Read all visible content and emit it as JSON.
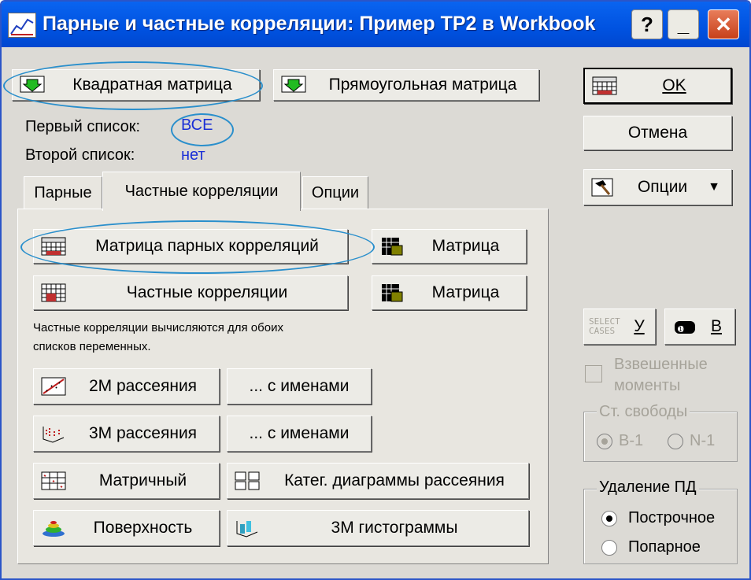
{
  "window": {
    "title": "Парные и частные корреляции: Пример ТР2 в Workbook",
    "help_btn": "?",
    "min_btn": "_",
    "close_btn": "✕"
  },
  "top_buttons": {
    "square_matrix": "Квадратная матрица",
    "rect_matrix": "Прямоугольная матрица"
  },
  "lists": {
    "first_label": "Первый список:",
    "first_value": "ВСЕ",
    "second_label": "Второй список:",
    "second_value": "нет"
  },
  "tabs": [
    "Парные",
    "Частные корреляции",
    "Опции"
  ],
  "panel": {
    "pair_matrix": "Матрица парных корреляций",
    "matrix1": "Матрица",
    "partial": "Частные корреляции",
    "matrix2": "Матрица",
    "note_line1": "Частные корреляции вычисляются для обоих",
    "note_line2": "списков переменных.",
    "scatter2d": "2М рассеяния",
    "with_names1": "... с именами",
    "scatter3d": "3М рассеяния",
    "with_names2": "... с именами",
    "matrix_plot": "Матричный",
    "categ": "Катег. диаграммы рассеяния",
    "surface": "Поверхность",
    "hist3d": "3М гистограммы"
  },
  "right": {
    "ok": "OK",
    "cancel": "Отмена",
    "options": "Опции",
    "select_cases": "SELECT CASES",
    "select_key": "У",
    "weight_key": "В",
    "weighted_line1": "Взвешенные",
    "weighted_line2": "моменты",
    "df_group": "Ст. свободы",
    "df_opt1": "В-1",
    "df_opt2": "N-1",
    "md_group": "Удаление ПД",
    "md_opt1": "Построчное",
    "md_opt2": "Попарное"
  },
  "colors": {
    "title_bar": "#0055e5",
    "value_blue": "#1a2fd6",
    "annotation": "#2a8fcc"
  }
}
